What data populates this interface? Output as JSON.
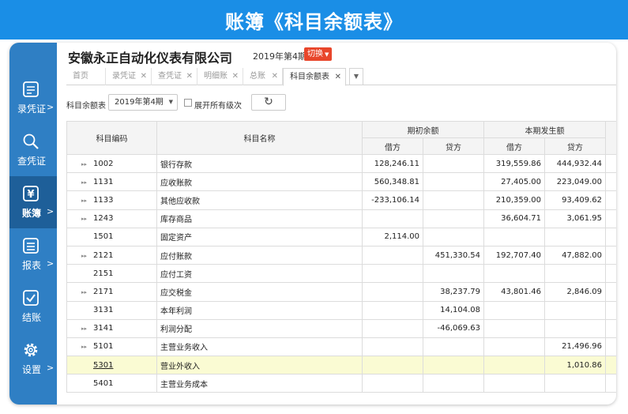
{
  "banner": {
    "title": "账簿《科目余额表》"
  },
  "sidebar": {
    "items": [
      {
        "label": "录凭证",
        "icon": "voucher-entry-icon",
        "arrow": ">"
      },
      {
        "label": "查凭证",
        "icon": "search-icon",
        "arrow": ""
      },
      {
        "label": "账簿",
        "icon": "yen-icon",
        "arrow": ">"
      },
      {
        "label": "报表",
        "icon": "report-icon",
        "arrow": ">"
      },
      {
        "label": "结账",
        "icon": "checkmark-icon",
        "arrow": ""
      },
      {
        "label": "设置",
        "icon": "gear-icon",
        "arrow": ">"
      }
    ],
    "active_index": 2,
    "bg_color": "#2f7fc4",
    "active_color": "#1e5f99"
  },
  "header": {
    "company": "安徽永正自动化仪表有限公司",
    "period": "2019年第4期",
    "switch_label": "切换",
    "switch_color": "#e8462b"
  },
  "tabs": [
    {
      "label": "首页",
      "closable": false
    },
    {
      "label": "录凭证",
      "closable": true
    },
    {
      "label": "查凭证",
      "closable": true
    },
    {
      "label": "明细账",
      "closable": true
    },
    {
      "label": "总账",
      "closable": true
    },
    {
      "label": "科目余额表",
      "closable": true,
      "active": true
    }
  ],
  "toolbar": {
    "label": "科目余额表",
    "period_value": "2019年第4期",
    "show_all_levels_label": "展开所有级次",
    "show_all_levels_checked": false
  },
  "table": {
    "headers": {
      "code": "科目编码",
      "name": "科目名称",
      "opening": "期初余额",
      "current": "本期发生额",
      "debit": "借方",
      "credit": "贷方"
    },
    "rows": [
      {
        "code": "1002",
        "name": "银行存款",
        "expandable": true,
        "open_debit": "128,246.11",
        "open_credit": "",
        "cur_debit": "319,559.86",
        "cur_credit": "444,932.44"
      },
      {
        "code": "1131",
        "name": "应收账款",
        "expandable": true,
        "open_debit": "560,348.81",
        "open_credit": "",
        "cur_debit": "27,405.00",
        "cur_credit": "223,049.00"
      },
      {
        "code": "1133",
        "name": "其他应收款",
        "expandable": true,
        "open_debit": "-233,106.14",
        "open_credit": "",
        "cur_debit": "210,359.00",
        "cur_credit": "93,409.62"
      },
      {
        "code": "1243",
        "name": "库存商品",
        "expandable": true,
        "open_debit": "",
        "open_credit": "",
        "cur_debit": "36,604.71",
        "cur_credit": "3,061.95"
      },
      {
        "code": "1501",
        "name": "固定资产",
        "expandable": false,
        "open_debit": "2,114.00",
        "open_credit": "",
        "cur_debit": "",
        "cur_credit": ""
      },
      {
        "code": "2121",
        "name": "应付账款",
        "expandable": true,
        "open_debit": "",
        "open_credit": "451,330.54",
        "cur_debit": "192,707.40",
        "cur_credit": "47,882.00"
      },
      {
        "code": "2151",
        "name": "应付工资",
        "expandable": false,
        "open_debit": "",
        "open_credit": "",
        "cur_debit": "",
        "cur_credit": ""
      },
      {
        "code": "2171",
        "name": "应交税金",
        "expandable": true,
        "open_debit": "",
        "open_credit": "38,237.79",
        "cur_debit": "43,801.46",
        "cur_credit": "2,846.09"
      },
      {
        "code": "3131",
        "name": "本年利润",
        "expandable": false,
        "open_debit": "",
        "open_credit": "14,104.08",
        "cur_debit": "",
        "cur_credit": ""
      },
      {
        "code": "3141",
        "name": "利润分配",
        "expandable": true,
        "open_debit": "",
        "open_credit": "-46,069.63",
        "cur_debit": "",
        "cur_credit": ""
      },
      {
        "code": "5101",
        "name": "主营业务收入",
        "expandable": true,
        "open_debit": "",
        "open_credit": "",
        "cur_debit": "",
        "cur_credit": "21,496.96"
      },
      {
        "code": "5301",
        "name": "营业外收入",
        "expandable": false,
        "open_debit": "",
        "open_credit": "",
        "cur_debit": "",
        "cur_credit": "1,010.86",
        "highlight": true
      },
      {
        "code": "5401",
        "name": "主营业务成本",
        "expandable": false,
        "open_debit": "",
        "open_credit": "",
        "cur_debit": "",
        "cur_credit": ""
      }
    ]
  }
}
